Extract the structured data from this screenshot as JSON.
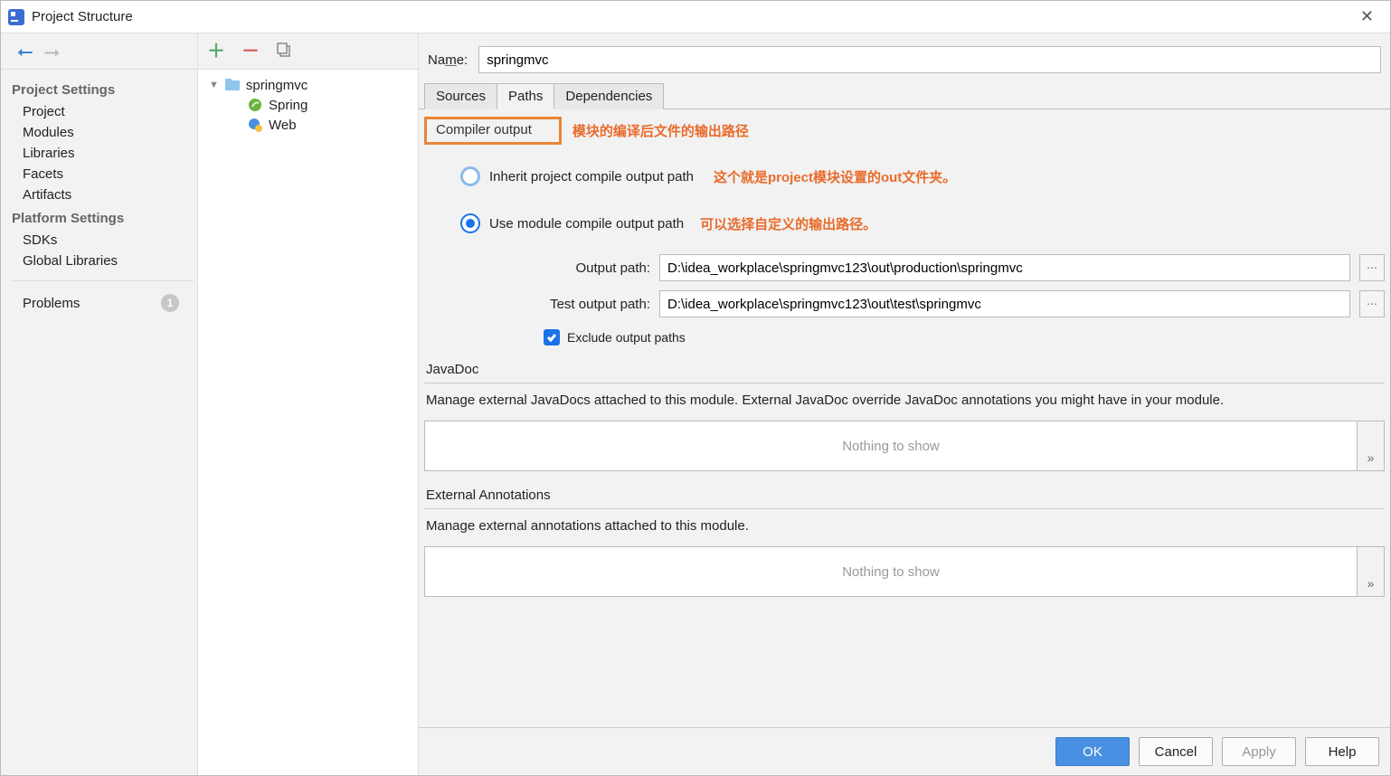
{
  "window": {
    "title": "Project Structure",
    "close": "✕"
  },
  "leftNav": {
    "sections": [
      {
        "heading": "Project Settings",
        "items": [
          "Project",
          "Modules",
          "Libraries",
          "Facets",
          "Artifacts"
        ]
      },
      {
        "heading": "Platform Settings",
        "items": [
          "SDKs",
          "Global Libraries"
        ]
      }
    ],
    "problems": {
      "label": "Problems",
      "count": "1"
    }
  },
  "tree": {
    "root": "springmvc",
    "children": [
      "Spring",
      "Web"
    ]
  },
  "main": {
    "nameLabel": "Name:",
    "nameValue": "springmvc",
    "tabs": [
      "Sources",
      "Paths",
      "Dependencies"
    ],
    "activeTab": "Paths",
    "compiler": {
      "heading": "Compiler output",
      "annot_heading": "模块的编译后文件的输出路径",
      "radio1": "Inherit project compile output path",
      "annot_radio1": "这个就是project模块设置的out文件夹。",
      "radio2": "Use module compile output path",
      "annot_radio2": "可以选择自定义的输出路径。",
      "outputPathLabel": "Output path:",
      "outputPathValue": "D:\\idea_workplace\\springmvc123\\out\\production\\springmvc",
      "testOutputLabel": "Test output path:",
      "testOutputValue": "D:\\idea_workplace\\springmvc123\\out\\test\\springmvc",
      "excludeLabel": "Exclude output paths"
    },
    "javadoc": {
      "heading": "JavaDoc",
      "desc": "Manage external JavaDocs attached to this module. External JavaDoc override JavaDoc annotations you might have in your module.",
      "empty": "Nothing to show",
      "expand": "»"
    },
    "extAnnot": {
      "heading": "External Annotations",
      "desc": "Manage external annotations attached to this module.",
      "empty": "Nothing to show",
      "expand": "»"
    }
  },
  "footer": {
    "ok": "OK",
    "cancel": "Cancel",
    "apply": "Apply",
    "help": "Help"
  }
}
